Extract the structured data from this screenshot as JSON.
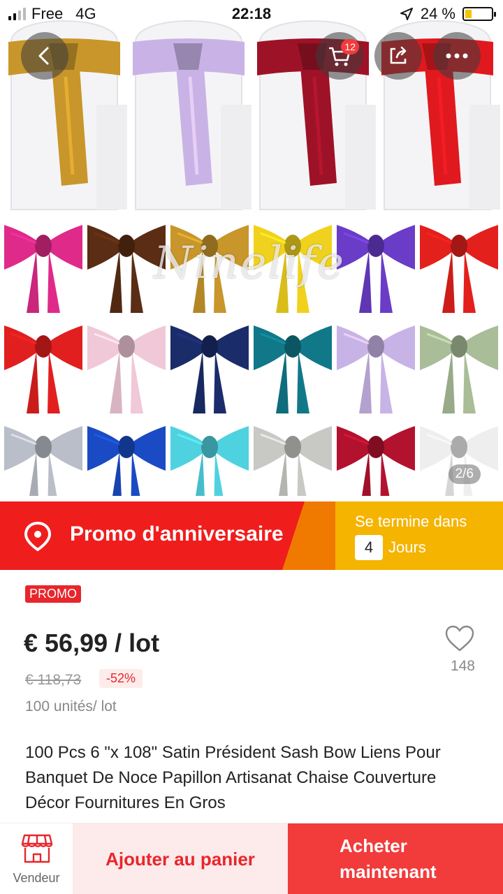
{
  "status_bar": {
    "carrier": "Free",
    "network": "4G",
    "time": "22:18",
    "battery_percent": "24 %",
    "battery_level": 0.24
  },
  "gallery": {
    "watermark": "Ninelife",
    "page_indicator": "2/6",
    "cart_count": "12",
    "chair_sash_colors": [
      "#c8962a",
      "#c9b3e6",
      "#9e1228",
      "#e0191f"
    ],
    "bow_rows": [
      [
        "#e02a8a",
        "#5a2d14",
        "#c8962a",
        "#f0d21e",
        "#6a3cc8",
        "#e3201c"
      ],
      [
        "#e11f1f",
        "#f0c8d8",
        "#1b2c6b",
        "#11788a",
        "#c8b3e6",
        "#a9bd98"
      ],
      [
        "#b9bec8",
        "#1a4bc4",
        "#4fd2e0",
        "#c8c8c4",
        "#b3122f",
        "#eeeeee"
      ]
    ]
  },
  "promo": {
    "title": "Promo d'anniversaire",
    "ends_label": "Se termine dans",
    "days_value": "4",
    "days_unit": "Jours"
  },
  "product": {
    "badge": "PROMO",
    "price": "€ 56,99 / lot",
    "old_price": "€ 118,73",
    "discount": "-52%",
    "units": "100 unités/ lot",
    "wishlist_count": "148",
    "title": "100 Pcs 6 \"x 108\" Satin Président Sash Bow Liens Pour Banquet De Noce Papillon Artisanat Chaise Couverture Décor Fournitures En Gros"
  },
  "bottom_bar": {
    "vendor_label": "Vendeur",
    "add_to_cart": "Ajouter au panier",
    "buy_now_line1": "Acheter",
    "buy_now_line2": "maintenant"
  },
  "colors": {
    "accent_red": "#f23b3b",
    "promo_red": "#f01d1d",
    "promo_yellow": "#f5b400"
  }
}
